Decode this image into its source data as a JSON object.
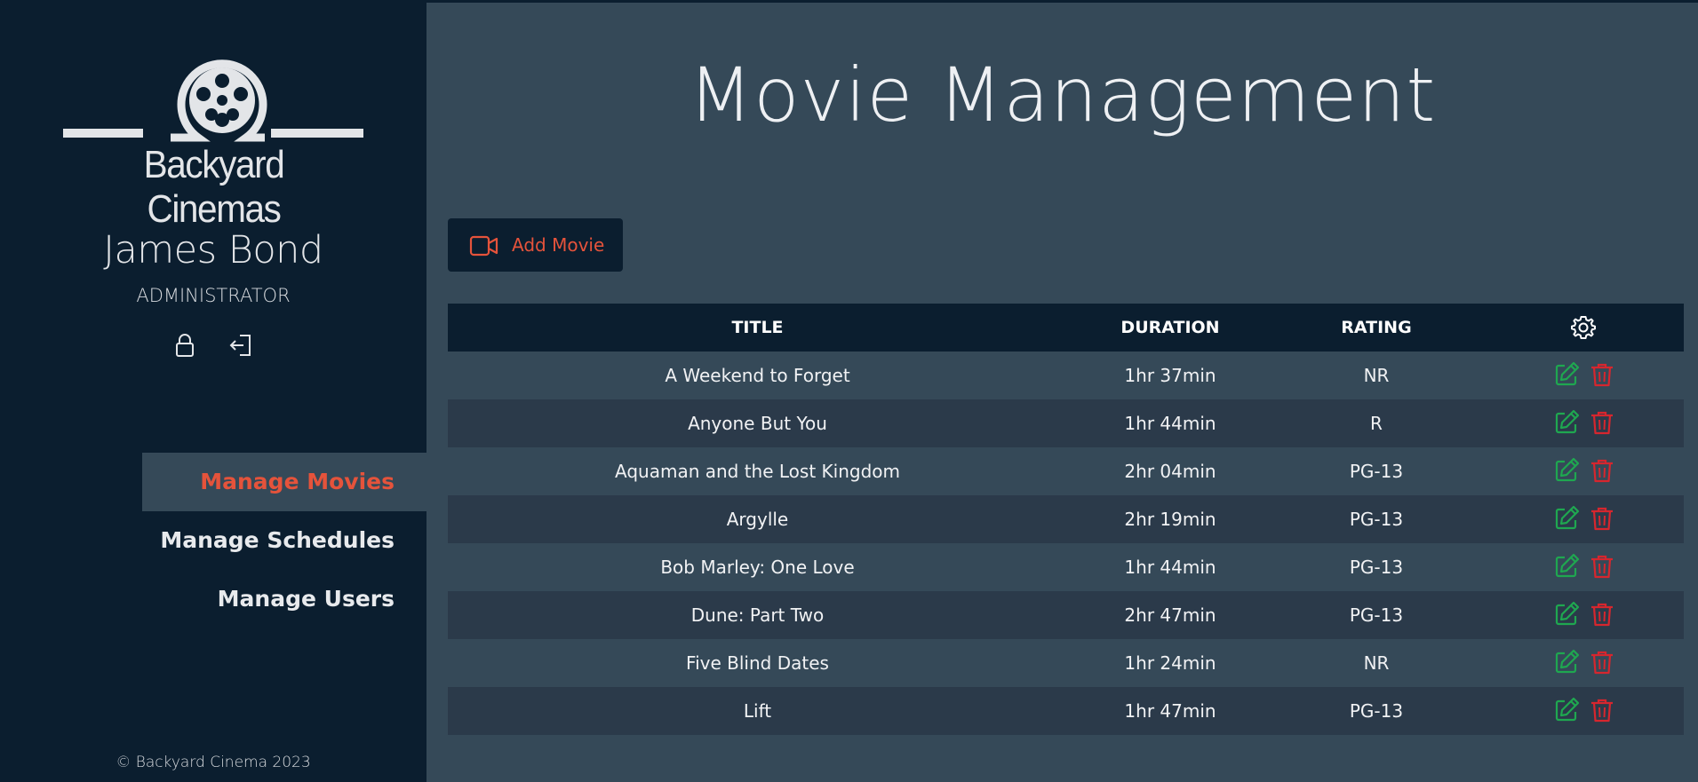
{
  "brand": {
    "name": "Backyard Cinemas"
  },
  "user": {
    "name": "James Bond",
    "role": "ADMINISTRATOR"
  },
  "user_actions": [
    {
      "icon": "lock-icon"
    },
    {
      "icon": "logout-icon"
    }
  ],
  "nav": {
    "items": [
      {
        "label": "Manage Movies",
        "active": true
      },
      {
        "label": "Manage Schedules",
        "active": false
      },
      {
        "label": "Manage Users",
        "active": false
      }
    ]
  },
  "footer": {
    "copyright": "© Backyard Cinema 2023"
  },
  "page": {
    "title": "Movie Management"
  },
  "toolbar": {
    "add_label": "Add Movie",
    "add_icon": "video-camera-icon"
  },
  "table": {
    "columns": {
      "title": "TITLE",
      "duration": "DURATION",
      "rating": "RATING",
      "actions_icon": "gear-icon"
    },
    "rows": [
      {
        "title": "A Weekend to Forget",
        "duration": "1hr 37min",
        "rating": "NR"
      },
      {
        "title": "Anyone But You",
        "duration": "1hr 44min",
        "rating": "R"
      },
      {
        "title": "Aquaman and the Lost Kingdom",
        "duration": "2hr 04min",
        "rating": "PG-13"
      },
      {
        "title": "Argylle",
        "duration": "2hr 19min",
        "rating": "PG-13"
      },
      {
        "title": "Bob Marley: One Love",
        "duration": "1hr 44min",
        "rating": "PG-13"
      },
      {
        "title": "Dune: Part Two",
        "duration": "2hr 47min",
        "rating": "PG-13"
      },
      {
        "title": "Five Blind Dates",
        "duration": "1hr 24min",
        "rating": "NR"
      },
      {
        "title": "Lift",
        "duration": "1hr 47min",
        "rating": "PG-13"
      }
    ],
    "row_actions": {
      "edit_icon": "edit-icon",
      "delete_icon": "trash-icon"
    }
  },
  "colors": {
    "sidebar_bg": "#0b1e2f",
    "main_bg": "#354958",
    "accent": "#e5533b",
    "edit": "#1fa750",
    "delete": "#d6262e"
  }
}
